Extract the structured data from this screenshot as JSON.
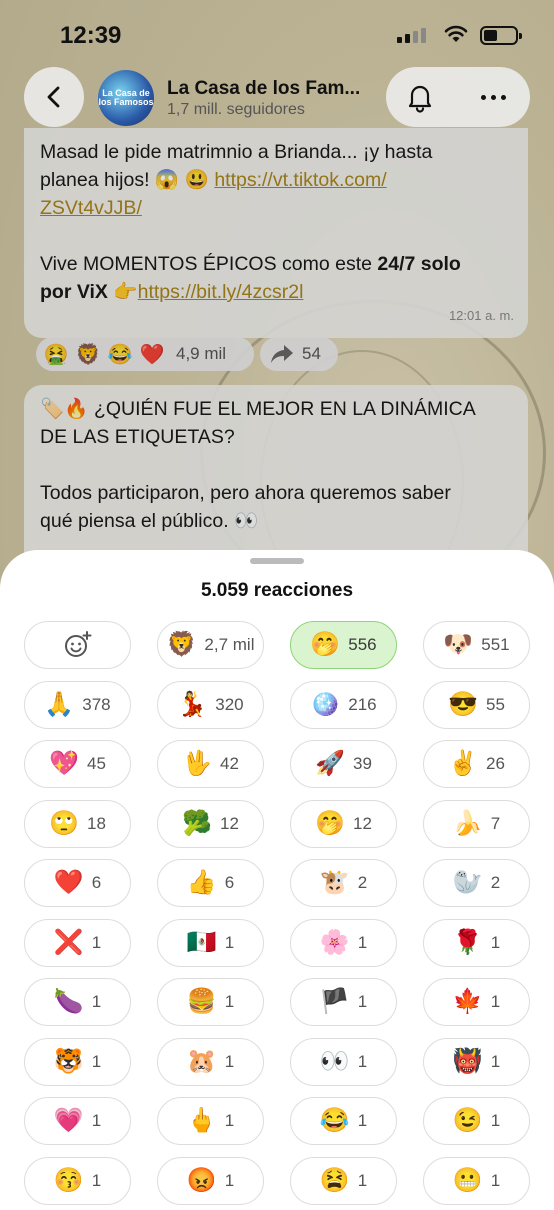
{
  "status": {
    "time": "12:39"
  },
  "channel": {
    "title": "La Casa de los Fam...",
    "subtitle": "1,7 mill. seguidores",
    "avatar_text": "La Casa de los Famosos"
  },
  "message1": {
    "line1": "Masad le pide matrimnio a Brianda... ¡y hasta",
    "line2_text": "planea hijos! 😱 😃 ",
    "line2_link": "https://vt.tiktok.com/",
    "line3_link": "ZSVt4vJJB/",
    "line4_text": "Vive MOMENTOS ÉPICOS como este ",
    "line4_bold": "24/7 solo",
    "line5_bold": "por ViX",
    "line5_text": " 👉",
    "line5_link": "https://bit.ly/4zcsr2l",
    "time": "12:01 a. m."
  },
  "reactions_bar": {
    "emojis": [
      "🤮",
      "🦁",
      "😂",
      "❤️"
    ],
    "count": "4,9 mil",
    "shares": "54"
  },
  "message2": {
    "line1": "🏷️🔥 ¿QUIÉN FUE EL MEJOR EN LA DINÁMICA",
    "line2": "DE LAS ETIQUETAS?",
    "line3": "Todos participaron, pero ahora queremos saber",
    "line4": "qué piensa el público. 👀"
  },
  "sheet": {
    "title": "5.059 reacciones",
    "chips": [
      {
        "emoji": "add-reaction-icon",
        "count": ""
      },
      {
        "emoji": "🦁",
        "count": "2,7 mil"
      },
      {
        "emoji": "🤭",
        "count": "556",
        "selected": true
      },
      {
        "emoji": "🐶",
        "count": "551"
      },
      {
        "emoji": "🙏",
        "count": "378"
      },
      {
        "emoji": "💃",
        "count": "320"
      },
      {
        "emoji": "🪩",
        "count": "216"
      },
      {
        "emoji": "😎",
        "count": "55"
      },
      {
        "emoji": "💖",
        "count": "45"
      },
      {
        "emoji": "🖖",
        "count": "42"
      },
      {
        "emoji": "🚀",
        "count": "39"
      },
      {
        "emoji": "✌️",
        "count": "26"
      },
      {
        "emoji": "🙄",
        "count": "18"
      },
      {
        "emoji": "🥦",
        "count": "12"
      },
      {
        "emoji": "🤭",
        "count": "12"
      },
      {
        "emoji": "🍌",
        "count": "7"
      },
      {
        "emoji": "❤️",
        "count": "6"
      },
      {
        "emoji": "👍",
        "count": "6"
      },
      {
        "emoji": "🐮",
        "count": "2"
      },
      {
        "emoji": "🦭",
        "count": "2"
      },
      {
        "emoji": "❌",
        "count": "1"
      },
      {
        "emoji": "🇲🇽",
        "count": "1"
      },
      {
        "emoji": "🌸",
        "count": "1"
      },
      {
        "emoji": "🌹",
        "count": "1"
      },
      {
        "emoji": "🍆",
        "count": "1"
      },
      {
        "emoji": "🍔",
        "count": "1"
      },
      {
        "emoji": "🏴",
        "count": "1"
      },
      {
        "emoji": "🍁",
        "count": "1"
      },
      {
        "emoji": "🐯",
        "count": "1"
      },
      {
        "emoji": "🐹",
        "count": "1"
      },
      {
        "emoji": "👀",
        "count": "1"
      },
      {
        "emoji": "👹",
        "count": "1"
      },
      {
        "emoji": "💗",
        "count": "1"
      },
      {
        "emoji": "🖕",
        "count": "1"
      },
      {
        "emoji": "😂",
        "count": "1"
      },
      {
        "emoji": "😉",
        "count": "1"
      },
      {
        "emoji": "😚",
        "count": "1"
      },
      {
        "emoji": "😡",
        "count": "1"
      },
      {
        "emoji": "😫",
        "count": "1"
      },
      {
        "emoji": "😬",
        "count": "1"
      }
    ]
  },
  "colors": {
    "link": "#a8851c",
    "selected_chip": "#daf4cf"
  }
}
